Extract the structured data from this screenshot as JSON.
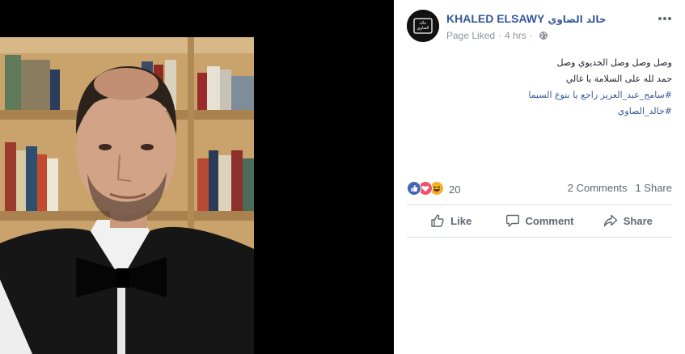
{
  "page": {
    "name": "KHALED ELSAWY",
    "name_ar": "خالد الصاوي",
    "status": "Page Liked",
    "time": "4 hrs",
    "privacy_icon": "globe-icon",
    "avatar_logo_text": "خالد الصاوي"
  },
  "post": {
    "lines": [
      "وصل وصل وصل الخديوي وصل",
      "حمد لله على السلامة يا غالي"
    ],
    "hashtags": [
      "#سامح_عبد_العزيز راجع يا بتوع السيما",
      "#خالد_الصاوي"
    ]
  },
  "stats": {
    "reaction_icons": [
      "like-reaction-icon",
      "love-reaction-icon",
      "haha-reaction-icon"
    ],
    "reaction_count": "20",
    "comments": "2 Comments",
    "shares": "1 Share"
  },
  "actions": {
    "like": "Like",
    "comment": "Comment",
    "share": "Share"
  },
  "colors": {
    "link": "#365899",
    "text": "#1d2129",
    "meta": "#90949c",
    "action": "#606770",
    "photo_bg": "#000000"
  }
}
